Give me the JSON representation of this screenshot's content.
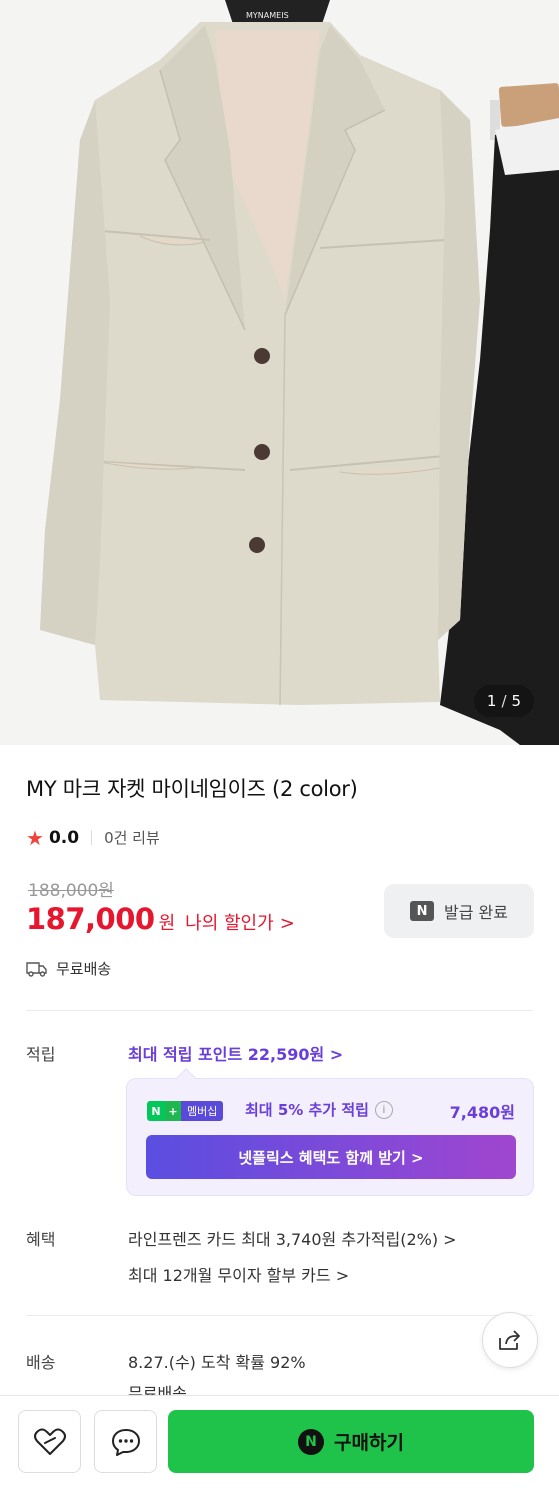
{
  "gallery": {
    "hanger_brand": "MYNAMEIS",
    "current_index": "1",
    "total": "5",
    "separator": "/"
  },
  "product": {
    "title": "MY 마크 자켓 마이네임이즈 (2 color)",
    "rating": "0.0",
    "review_count": "0건 리뷰",
    "original_price": "188,000원",
    "sale_price": "187,000",
    "currency": "원",
    "my_discount_label": "나의 할인가",
    "chevron": ">"
  },
  "coupon": {
    "badge": "N",
    "label": "발급 완료"
  },
  "shipping": {
    "label": "무료배송"
  },
  "points": {
    "section_label": "적립",
    "max_point_text": "최대 적립 포인트 22,590원 >",
    "membership_badge": {
      "n": "N",
      "plus": "+",
      "label": "멤버십"
    },
    "extra_text": "최대 5% 추가 적립",
    "info_icon": "i",
    "extra_amount": "7,480원",
    "netflix_button": "넷플릭스 혜택도 함께 받기 >"
  },
  "benefits": {
    "section_label": "혜택",
    "items": [
      "라인프렌즈 카드 최대 3,740원 추가적립(2%) >",
      "최대 12개월 무이자 할부 카드 >"
    ]
  },
  "delivery": {
    "section_label": "배송",
    "arrival": "8.27.(수) 도착 확률 92%",
    "free": "무료배송"
  },
  "bottom": {
    "buy_logo": "N",
    "buy_label": "구매하기"
  },
  "colors": {
    "sale_red": "#e5162e",
    "point_purple": "#6a3fd9",
    "buy_green": "#1fc34a",
    "jacket": "#ddd9cb"
  },
  "icons": [
    "heart-icon",
    "chat-icon",
    "share-icon",
    "truck-icon",
    "star-icon",
    "info-icon"
  ]
}
